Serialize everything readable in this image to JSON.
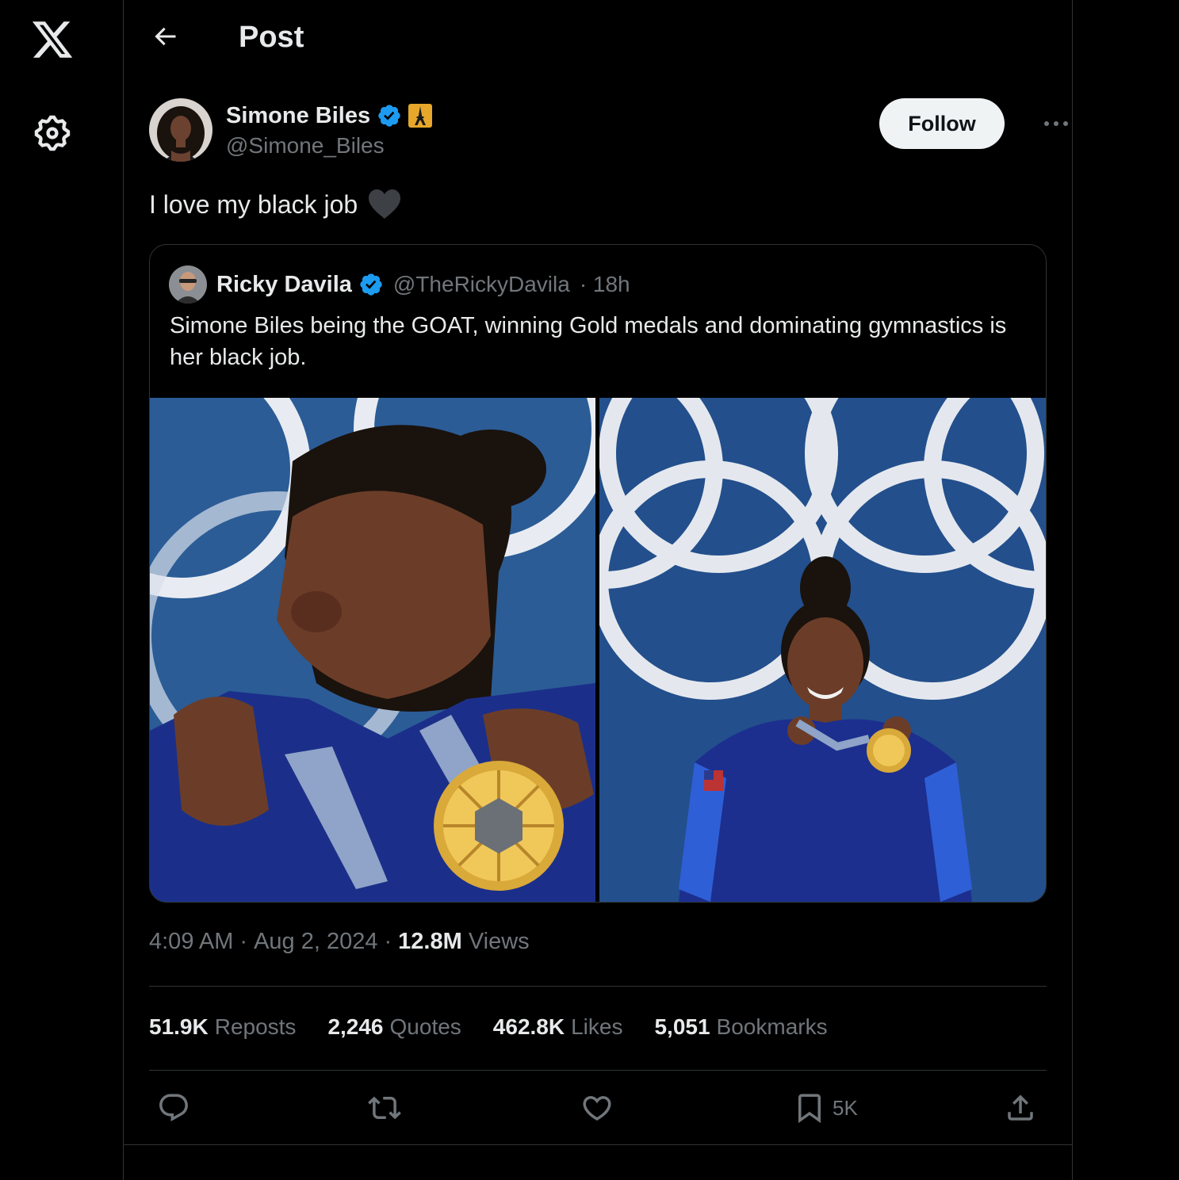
{
  "nav": {
    "logo": "x-logo-icon",
    "settings": "gear-icon"
  },
  "header": {
    "back": "back-arrow-icon",
    "title": "Post"
  },
  "post": {
    "author": {
      "display_name": "Simone Biles",
      "handle": "@Simone_Biles",
      "verified": true,
      "extra_badge": "eiffel-tower-badge-icon"
    },
    "follow_label": "Follow",
    "text": "I love my black job",
    "text_emoji": "black-heart-icon",
    "quote": {
      "display_name": "Ricky Davila",
      "handle": "@TheRickyDavila",
      "time": "· 18h",
      "text": "Simone Biles being the GOAT, winning Gold medals and dominating gymnastics is her black job.",
      "photos": [
        "medal-closeup-photo",
        "olympic-rings-photo"
      ]
    },
    "timestamp": {
      "time": "4:09 AM",
      "date": "Aug 2, 2024",
      "views_count": "12.8M",
      "views_label": "Views"
    },
    "stats": [
      {
        "count": "51.9K",
        "label": "Reposts"
      },
      {
        "count": "2,246",
        "label": "Quotes"
      },
      {
        "count": "462.8K",
        "label": "Likes"
      },
      {
        "count": "5,051",
        "label": "Bookmarks"
      }
    ],
    "actions": {
      "bookmark_count": "5K"
    }
  },
  "colors": {
    "background": "#000000",
    "text": "#e7e9ea",
    "secondary": "#71767b",
    "border": "#2f3336",
    "verified": "#1d9bf0"
  }
}
